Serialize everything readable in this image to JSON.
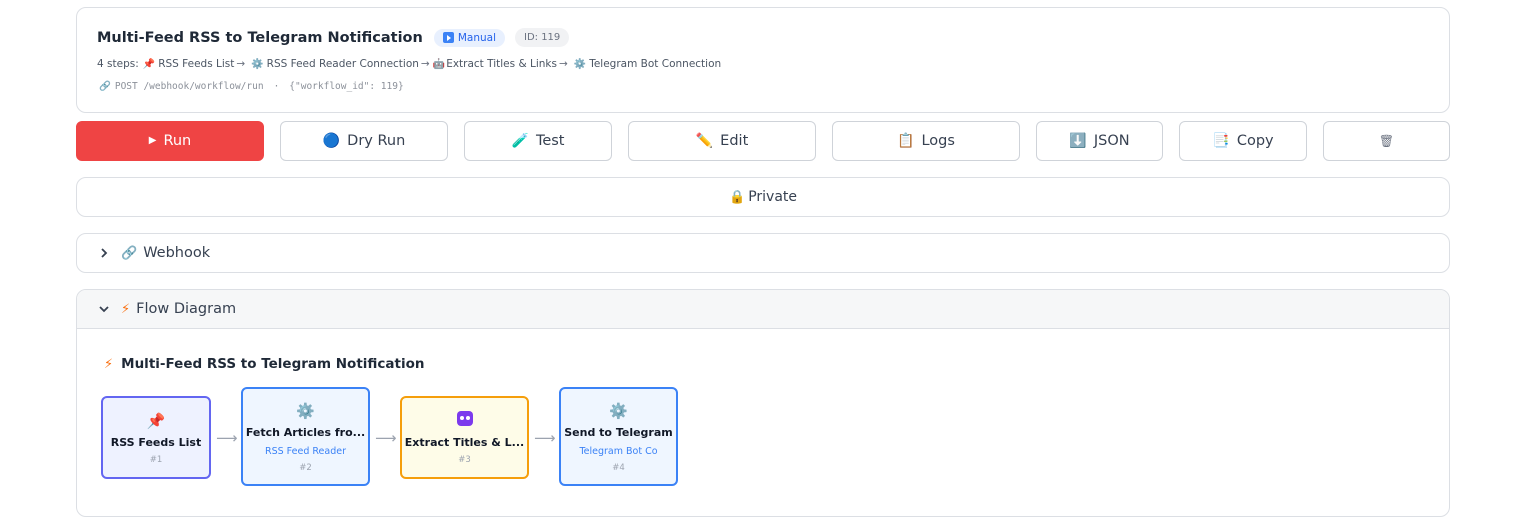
{
  "header": {
    "title": "Multi-Feed RSS to Telegram Notification",
    "trigger_badge": "Manual",
    "id_badge": "ID: 119",
    "steps_prefix": "4 steps:",
    "steps": [
      {
        "icon": "pushpin-icon",
        "label": "RSS Feeds List"
      },
      {
        "icon": "gear-icon",
        "label": "RSS Feed Reader Connection"
      },
      {
        "icon": "robot-icon",
        "label": "Extract Titles & Links"
      },
      {
        "icon": "gear-icon",
        "label": "Telegram Bot Connection"
      }
    ],
    "webhook_method": "POST /webhook/workflow/run",
    "webhook_sep": "·",
    "webhook_payload": "{\"workflow_id\": 119}"
  },
  "actions": {
    "run": "Run",
    "dry_run": "Dry Run",
    "test": "Test",
    "edit": "Edit",
    "logs": "Logs",
    "json": "JSON",
    "copy": "Copy",
    "delete": ""
  },
  "visibility": {
    "label": "Private"
  },
  "sections": {
    "webhook": "Webhook",
    "flow_diagram": "Flow Diagram"
  },
  "diagram": {
    "title": "Multi-Feed RSS to Telegram Notification",
    "nodes": [
      {
        "icon": "pushpin-icon",
        "title": "RSS Feeds List",
        "subtitle": "",
        "num": "#1"
      },
      {
        "icon": "gear-icon",
        "title": "Fetch Articles fro...",
        "subtitle": "RSS Feed Reader",
        "num": "#2"
      },
      {
        "icon": "robot-icon",
        "title": "Extract Titles & L...",
        "subtitle": "",
        "num": "#3"
      },
      {
        "icon": "gear-icon",
        "title": "Send to Telegram",
        "subtitle": "Telegram Bot Co",
        "num": "#4"
      }
    ]
  },
  "colors": {
    "run_button": "#ef4444",
    "node1_border": "#6366f1",
    "node_blue_border": "#3b82f6",
    "node3_border": "#f59e0b",
    "bolt": "#f97316"
  }
}
